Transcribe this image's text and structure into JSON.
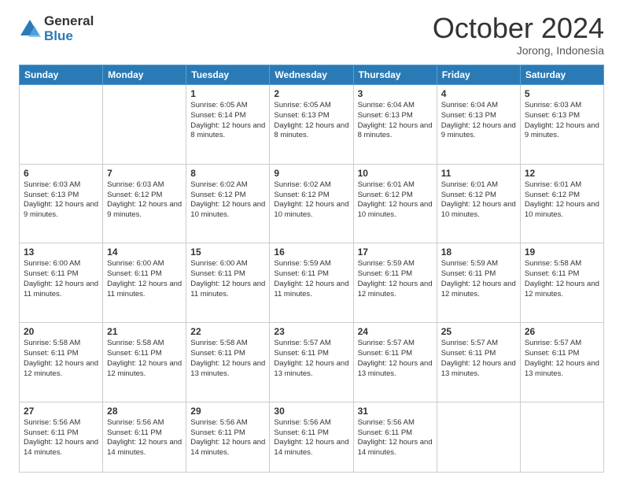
{
  "logo": {
    "general": "General",
    "blue": "Blue"
  },
  "header": {
    "month": "October 2024",
    "location": "Jorong, Indonesia"
  },
  "weekdays": [
    "Sunday",
    "Monday",
    "Tuesday",
    "Wednesday",
    "Thursday",
    "Friday",
    "Saturday"
  ],
  "weeks": [
    [
      {
        "day": "",
        "info": ""
      },
      {
        "day": "",
        "info": ""
      },
      {
        "day": "1",
        "info": "Sunrise: 6:05 AM\nSunset: 6:14 PM\nDaylight: 12 hours and 8 minutes."
      },
      {
        "day": "2",
        "info": "Sunrise: 6:05 AM\nSunset: 6:13 PM\nDaylight: 12 hours and 8 minutes."
      },
      {
        "day": "3",
        "info": "Sunrise: 6:04 AM\nSunset: 6:13 PM\nDaylight: 12 hours and 8 minutes."
      },
      {
        "day": "4",
        "info": "Sunrise: 6:04 AM\nSunset: 6:13 PM\nDaylight: 12 hours and 9 minutes."
      },
      {
        "day": "5",
        "info": "Sunrise: 6:03 AM\nSunset: 6:13 PM\nDaylight: 12 hours and 9 minutes."
      }
    ],
    [
      {
        "day": "6",
        "info": "Sunrise: 6:03 AM\nSunset: 6:13 PM\nDaylight: 12 hours and 9 minutes."
      },
      {
        "day": "7",
        "info": "Sunrise: 6:03 AM\nSunset: 6:12 PM\nDaylight: 12 hours and 9 minutes."
      },
      {
        "day": "8",
        "info": "Sunrise: 6:02 AM\nSunset: 6:12 PM\nDaylight: 12 hours and 10 minutes."
      },
      {
        "day": "9",
        "info": "Sunrise: 6:02 AM\nSunset: 6:12 PM\nDaylight: 12 hours and 10 minutes."
      },
      {
        "day": "10",
        "info": "Sunrise: 6:01 AM\nSunset: 6:12 PM\nDaylight: 12 hours and 10 minutes."
      },
      {
        "day": "11",
        "info": "Sunrise: 6:01 AM\nSunset: 6:12 PM\nDaylight: 12 hours and 10 minutes."
      },
      {
        "day": "12",
        "info": "Sunrise: 6:01 AM\nSunset: 6:12 PM\nDaylight: 12 hours and 10 minutes."
      }
    ],
    [
      {
        "day": "13",
        "info": "Sunrise: 6:00 AM\nSunset: 6:11 PM\nDaylight: 12 hours and 11 minutes."
      },
      {
        "day": "14",
        "info": "Sunrise: 6:00 AM\nSunset: 6:11 PM\nDaylight: 12 hours and 11 minutes."
      },
      {
        "day": "15",
        "info": "Sunrise: 6:00 AM\nSunset: 6:11 PM\nDaylight: 12 hours and 11 minutes."
      },
      {
        "day": "16",
        "info": "Sunrise: 5:59 AM\nSunset: 6:11 PM\nDaylight: 12 hours and 11 minutes."
      },
      {
        "day": "17",
        "info": "Sunrise: 5:59 AM\nSunset: 6:11 PM\nDaylight: 12 hours and 12 minutes."
      },
      {
        "day": "18",
        "info": "Sunrise: 5:59 AM\nSunset: 6:11 PM\nDaylight: 12 hours and 12 minutes."
      },
      {
        "day": "19",
        "info": "Sunrise: 5:58 AM\nSunset: 6:11 PM\nDaylight: 12 hours and 12 minutes."
      }
    ],
    [
      {
        "day": "20",
        "info": "Sunrise: 5:58 AM\nSunset: 6:11 PM\nDaylight: 12 hours and 12 minutes."
      },
      {
        "day": "21",
        "info": "Sunrise: 5:58 AM\nSunset: 6:11 PM\nDaylight: 12 hours and 12 minutes."
      },
      {
        "day": "22",
        "info": "Sunrise: 5:58 AM\nSunset: 6:11 PM\nDaylight: 12 hours and 13 minutes."
      },
      {
        "day": "23",
        "info": "Sunrise: 5:57 AM\nSunset: 6:11 PM\nDaylight: 12 hours and 13 minutes."
      },
      {
        "day": "24",
        "info": "Sunrise: 5:57 AM\nSunset: 6:11 PM\nDaylight: 12 hours and 13 minutes."
      },
      {
        "day": "25",
        "info": "Sunrise: 5:57 AM\nSunset: 6:11 PM\nDaylight: 12 hours and 13 minutes."
      },
      {
        "day": "26",
        "info": "Sunrise: 5:57 AM\nSunset: 6:11 PM\nDaylight: 12 hours and 13 minutes."
      }
    ],
    [
      {
        "day": "27",
        "info": "Sunrise: 5:56 AM\nSunset: 6:11 PM\nDaylight: 12 hours and 14 minutes."
      },
      {
        "day": "28",
        "info": "Sunrise: 5:56 AM\nSunset: 6:11 PM\nDaylight: 12 hours and 14 minutes."
      },
      {
        "day": "29",
        "info": "Sunrise: 5:56 AM\nSunset: 6:11 PM\nDaylight: 12 hours and 14 minutes."
      },
      {
        "day": "30",
        "info": "Sunrise: 5:56 AM\nSunset: 6:11 PM\nDaylight: 12 hours and 14 minutes."
      },
      {
        "day": "31",
        "info": "Sunrise: 5:56 AM\nSunset: 6:11 PM\nDaylight: 12 hours and 14 minutes."
      },
      {
        "day": "",
        "info": ""
      },
      {
        "day": "",
        "info": ""
      }
    ]
  ]
}
